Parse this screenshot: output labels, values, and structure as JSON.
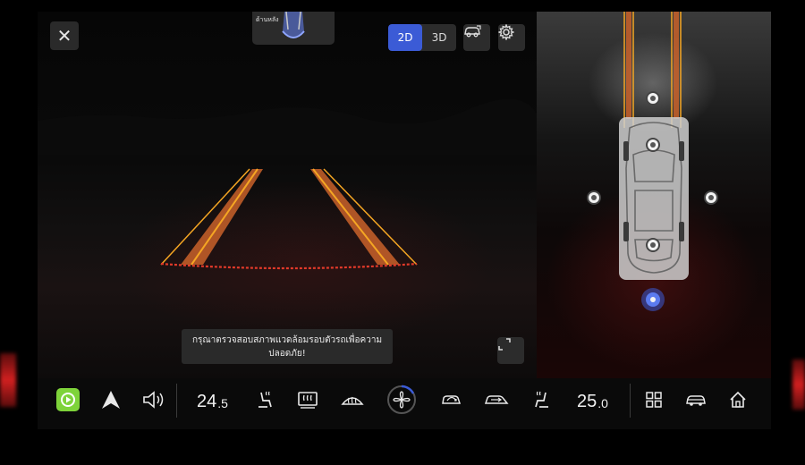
{
  "topbar": {
    "close_label": "✕",
    "rear_view_label": "ด้านหลัง",
    "view_modes": [
      "2D",
      "3D"
    ],
    "active_view_mode": "2D",
    "car_view_icon": "car-view-icon",
    "settings_icon": "gear-icon"
  },
  "toast": {
    "line1": "กรุณาตรวจสอบสภาพแวดล้อมรอบตัวรถเพื่อความ",
    "line2": "ปลอดภัย!"
  },
  "dock": {
    "temp_left": "24",
    "temp_left_decimal": ".5",
    "temp_right": "25",
    "temp_right_decimal": ".0",
    "items_left": [
      "carplay-icon",
      "android-auto-icon",
      "volume-icon"
    ],
    "climate_icons": [
      "seat-heat-left-icon",
      "rear-defrost-icon",
      "front-defrost-icon",
      "fan-icon",
      "recirculation-icon",
      "air-flow-icon",
      "seat-heat-right-icon"
    ],
    "items_right": [
      "app-grid-icon",
      "car-icon",
      "home-icon"
    ]
  },
  "colors": {
    "accent": "#3b5bd6",
    "guide_line": "#f5a623",
    "guide_fill": "#c9622a",
    "stop_line": "#e23a2a",
    "carplay_green": "#7ed33a"
  }
}
